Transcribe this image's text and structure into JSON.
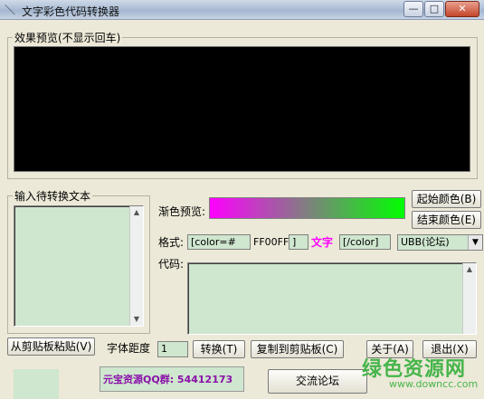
{
  "window": {
    "title": "文字彩色代码转换器",
    "app_icon": "＼",
    "min_glyph": "—",
    "max_glyph": "□",
    "close_glyph": "✕"
  },
  "preview_group": {
    "label": "效果预览(不显示回车)"
  },
  "input_group": {
    "label": "输入待转换文本",
    "value": ""
  },
  "gradient": {
    "label": "渐色预览:",
    "start_color": "#ff00ff",
    "end_color": "#00ff00",
    "start_button": "起始颜色(B)",
    "end_button": "结束颜色(E)"
  },
  "format": {
    "label": "格式:",
    "open_tag": "[color=#",
    "hex_value": "FF00FF",
    "close_bracket": "]",
    "sample_text": "文字",
    "sample_color": "#ff00ff",
    "end_tag": "[/color]",
    "mode_selected": "UBB(论坛)"
  },
  "code": {
    "label": "代码:",
    "value": ""
  },
  "bottom": {
    "paste_button": "从剪贴板粘贴(V)",
    "spacing_label": "字体距度",
    "spacing_value": "1",
    "convert_button": "转换(T)",
    "copy_button": "复制到剪贴板(C)",
    "about_button": "关于(A)",
    "exit_button": "退出(X)",
    "qq_text": "元宝资源QQ群: 54412173",
    "forum_button": "交流论坛"
  },
  "watermark": {
    "main": "绿色资源网",
    "url": "www.downcc.com"
  }
}
